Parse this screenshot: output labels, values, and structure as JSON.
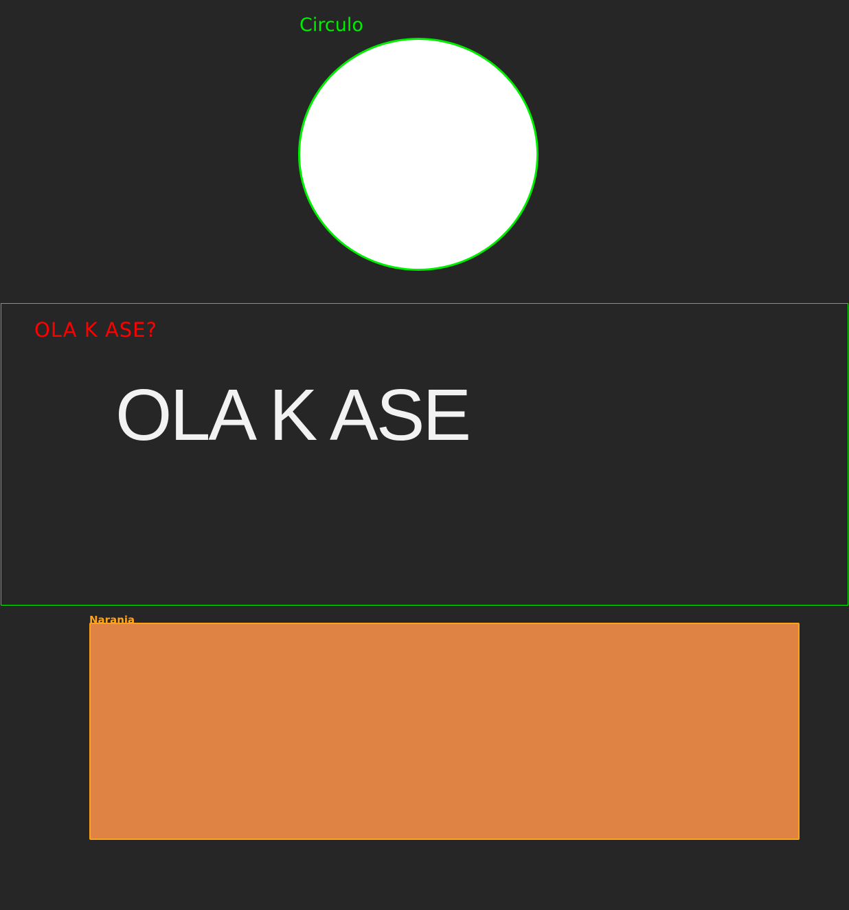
{
  "colors": {
    "background": "#262626",
    "green": "#00ee00",
    "red": "#ff0000",
    "white_text": "#f2f2f2",
    "circle_fill": "#ffffff",
    "orange_fill": "#df8344",
    "orange_border": "#ffa31a"
  },
  "circle": {
    "label": "Circulo"
  },
  "text_box": {
    "small_heading": "OLA K ASE?",
    "big_heading": "OLA K ASE"
  },
  "rectangle": {
    "label": "Naranja"
  }
}
